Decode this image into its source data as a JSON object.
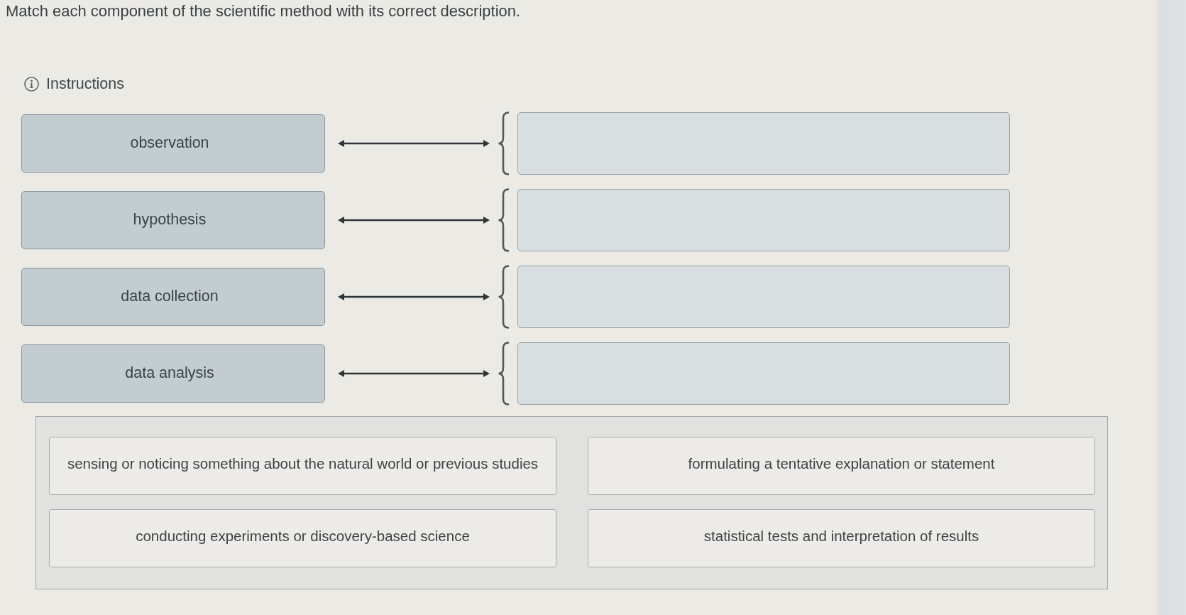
{
  "prompt": "Match each component of the scientific method with its correct description.",
  "instructions": {
    "label": "Instructions"
  },
  "matching_rows": [
    {
      "term": "observation"
    },
    {
      "term": "hypothesis"
    },
    {
      "term": "data collection"
    },
    {
      "term": "data analysis"
    }
  ],
  "answer_bank": [
    {
      "text": "sensing or noticing something about the natural world or previous studies"
    },
    {
      "text": "formulating a tentative explanation or statement"
    },
    {
      "text": "conducting experiments or discovery-based science"
    },
    {
      "text": "statistical tests and interpretation of results"
    }
  ]
}
